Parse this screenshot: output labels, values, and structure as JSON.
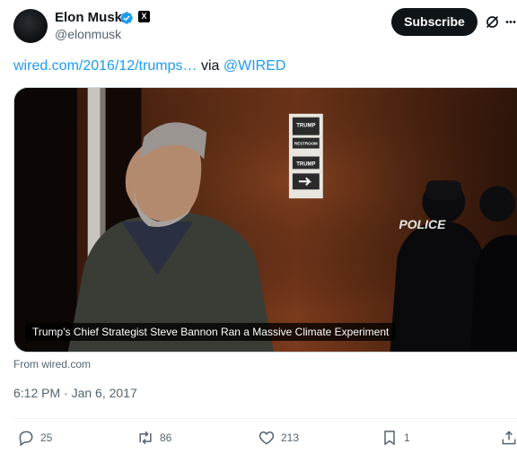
{
  "author": {
    "name": "Elon Musk",
    "handle": "@elonmusk",
    "affiliate_badge": "X"
  },
  "header": {
    "subscribe_label": "Subscribe"
  },
  "tweet": {
    "link_text": "wired.com/2016/12/trumps…",
    "via_text": " via ",
    "mention": "@WIRED"
  },
  "card": {
    "caption": "Trump's Chief Strategist Steve Bannon Ran a Massive Climate Experiment",
    "from": "From wired.com",
    "photo_labels": {
      "sign_top": "TRUMP",
      "sign_restroom": "RESTROOM",
      "sign_bottom": "TRUMP",
      "police": "POLICE"
    }
  },
  "meta": {
    "timestamp": "6:12 PM · Jan 6, 2017"
  },
  "actions": {
    "replies": "25",
    "reposts": "86",
    "likes": "213",
    "bookmarks": "1"
  },
  "colors": {
    "accent": "#1d9bf0",
    "text": "#0f1419",
    "secondary": "#536471"
  },
  "icons": [
    "verified-icon",
    "grok-icon",
    "more-icon",
    "reply-icon",
    "repost-icon",
    "like-icon",
    "bookmark-icon",
    "share-icon"
  ]
}
